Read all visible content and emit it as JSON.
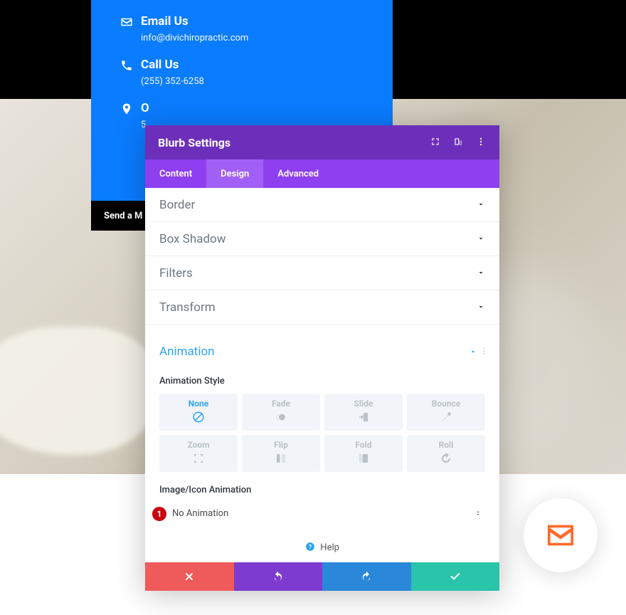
{
  "contact": {
    "email": {
      "title": "Email Us",
      "value": "info@divichiropractic.com"
    },
    "call": {
      "title": "Call Us",
      "value": "(255) 352-6258"
    },
    "loc_title_partial": "O",
    "loc_sub_partial": "5"
  },
  "button": {
    "send_partial": "Send a M"
  },
  "modal": {
    "title": "Blurb Settings",
    "tabs": {
      "content": "Content",
      "design": "Design",
      "advanced": "Advanced"
    },
    "active_tab": "design"
  },
  "sections": {
    "border": "Border",
    "box_shadow": "Box Shadow",
    "filters": "Filters",
    "transform": "Transform",
    "animation": "Animation"
  },
  "animation": {
    "style_label": "Animation Style",
    "options": {
      "none": "None",
      "fade": "Fade",
      "slide": "Slide",
      "bounce": "Bounce",
      "zoom": "Zoom",
      "flip": "Flip",
      "fold": "Fold",
      "roll": "Roll"
    },
    "selected": "none",
    "image_label": "Image/Icon Animation",
    "image_value": "No Animation",
    "badge": "1"
  },
  "help": "Help",
  "colors": {
    "header": "#6c2fb9",
    "tabs": "#8e3ff0",
    "accent": "#2ea3f2",
    "badge": "#c6050f",
    "fab": "#ff6a2c"
  }
}
